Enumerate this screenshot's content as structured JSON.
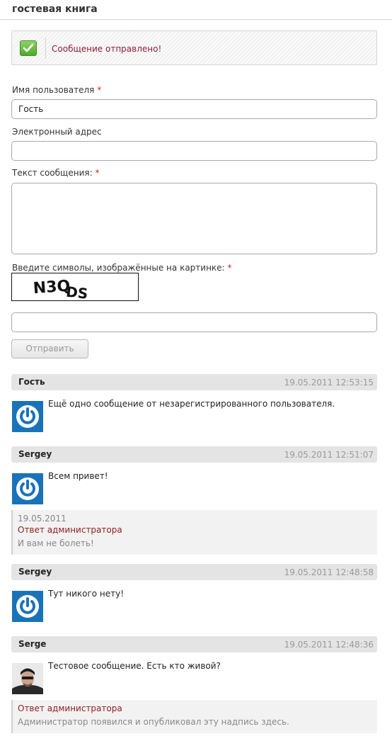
{
  "page": {
    "title": "гостевая книга"
  },
  "notice": {
    "text": "Сообщение отправлено!"
  },
  "form": {
    "name_label": "Имя пользователя",
    "name_value": "Гость",
    "email_label": "Электронный адрес",
    "email_value": "",
    "message_label": "Текст сообщения:",
    "message_value": "",
    "captcha_label": "Введите символы, изображённые на картинке:",
    "captcha_image_text": "N3QDS",
    "captcha_value": "",
    "required_mark": "*",
    "submit_label": "Отправить"
  },
  "messages": [
    {
      "author": "Гость",
      "date": "19.05.2011 12:53:15",
      "avatar": "power-icon",
      "text": "Ещё одно сообщение от незарегистрированного пользователя."
    },
    {
      "author": "Sergey",
      "date": "19.05.2011 12:51:07",
      "avatar": "power-icon",
      "text": "Всем привет!",
      "reply": {
        "date": "19.05.2011",
        "title": "Ответ администратора",
        "text": "И вам не болеть!"
      }
    },
    {
      "author": "Sergey",
      "date": "19.05.2011 12:48:58",
      "avatar": "power-icon",
      "text": "Тут никого нету!"
    },
    {
      "author": "Serge",
      "date": "19.05.2011 12:48:36",
      "avatar": "user-photo",
      "text": "Тестовое сообщение. Есть кто живой?",
      "reply": {
        "title": "Ответ администратора",
        "text": "Администратор появился и опубликовал эту надпись здесь."
      }
    }
  ],
  "colors": {
    "accent": "#8b1e3a",
    "required": "#d21b1b",
    "header_bg": "#e4e4e4",
    "avatar_bg": "#1a73b8"
  }
}
